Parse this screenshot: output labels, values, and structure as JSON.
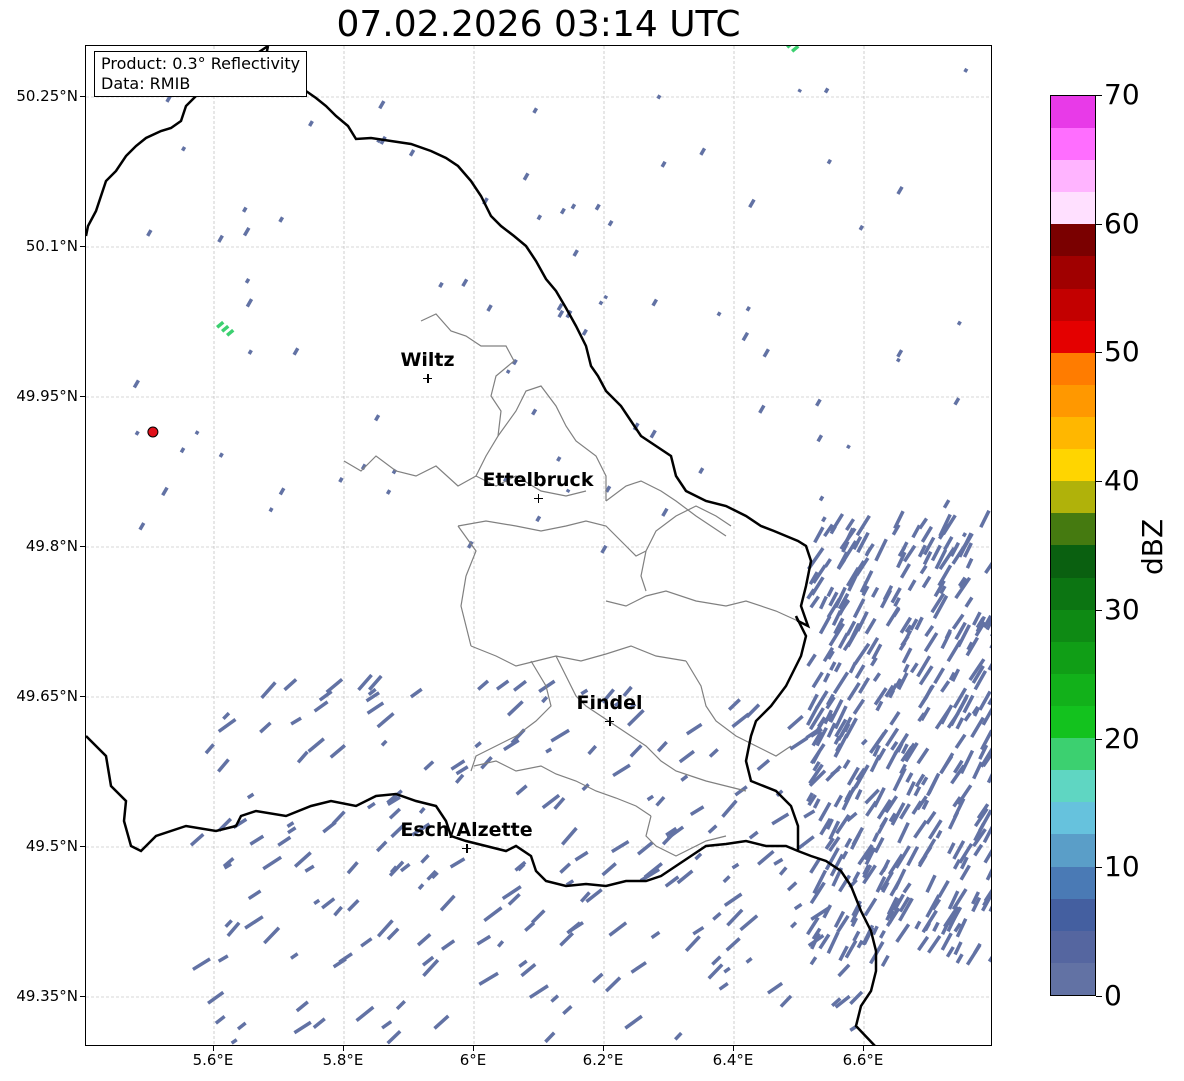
{
  "title": "07.02.2026 03:14 UTC",
  "info": {
    "product": "Product: 0.3° Reflectivity",
    "data": "Data: RMIB"
  },
  "map": {
    "lon_range": [
      5.4,
      6.8
    ],
    "lat_range": [
      49.28,
      50.3
    ],
    "lat_ticks": [
      {
        "value": 50.25,
        "label": "50.25°N"
      },
      {
        "value": 50.1,
        "label": "50.1°N"
      },
      {
        "value": 49.95,
        "label": "49.95°N"
      },
      {
        "value": 49.8,
        "label": "49.8°N"
      },
      {
        "value": 49.65,
        "label": "49.65°N"
      },
      {
        "value": 49.5,
        "label": "49.5°N"
      },
      {
        "value": 49.35,
        "label": "49.35°N"
      }
    ],
    "lon_ticks": [
      {
        "value": 5.6,
        "label": "5.6°E"
      },
      {
        "value": 5.8,
        "label": "5.8°E"
      },
      {
        "value": 6.0,
        "label": "6°E"
      },
      {
        "value": 6.2,
        "label": "6.2°E"
      },
      {
        "value": 6.4,
        "label": "6.4°E"
      },
      {
        "value": 6.6,
        "label": "6.6°E"
      }
    ],
    "cities": [
      {
        "name": "Wiltz",
        "lon": 5.93,
        "lat": 49.968
      },
      {
        "name": "Ettelbruck",
        "lon": 6.1,
        "lat": 49.848
      },
      {
        "name": "Findel",
        "lon": 6.21,
        "lat": 49.625
      },
      {
        "name": "Esch/Alzette",
        "lon": 5.99,
        "lat": 49.498
      }
    ],
    "radar_site": {
      "lon": 5.506,
      "lat": 49.915,
      "color": "#e0101a"
    },
    "colors": {
      "border": "#000000",
      "canton": "#808080",
      "grid": "#b0b0b0",
      "weak_echo": "#6272a4",
      "echo_green": "#3cd070"
    }
  },
  "colorbar": {
    "unit": "dBZ",
    "min": 0,
    "max": 70,
    "ticks": [
      0,
      10,
      20,
      30,
      40,
      50,
      60,
      70
    ],
    "colors": [
      "#6272a4",
      "#5566a0",
      "#445fa0",
      "#4a7ab5",
      "#5a9ec8",
      "#66c2dd",
      "#5fd6c2",
      "#3cd070",
      "#13c21e",
      "#12b11a",
      "#109e16",
      "#0e8a14",
      "#0c7512",
      "#0a6010",
      "#457a10",
      "#b0b20a",
      "#ffd500",
      "#ffb700",
      "#ff9800",
      "#ff7c00",
      "#e40000",
      "#c30000",
      "#a00000",
      "#7a0000",
      "#ffe0ff",
      "#ffb4ff",
      "#ff6eff",
      "#e83ae8"
    ]
  }
}
